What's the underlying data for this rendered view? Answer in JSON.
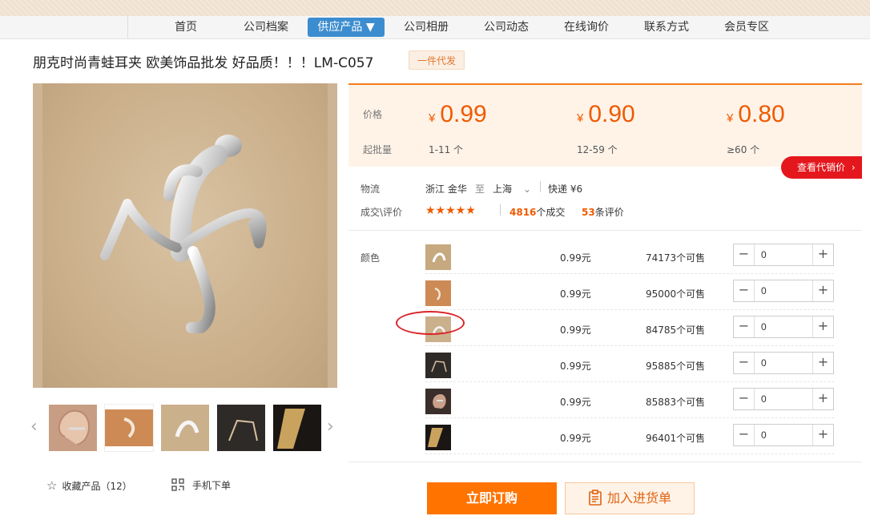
{
  "nav": {
    "items": [
      "首页",
      "公司档案",
      "供应产品 ▼",
      "公司相册",
      "公司动态",
      "在线询价",
      "联系方式",
      "会员专区"
    ]
  },
  "product": {
    "title": "朋克时尚青蛙耳夹 欧美饰品批发 好品质！！！LM-C057",
    "tag": "一件代发"
  },
  "price_section": {
    "price_label": "价格",
    "min_label": "起批量",
    "tiers": [
      {
        "currency": "¥",
        "price": "0.99",
        "range": "1-11 个"
      },
      {
        "currency": "¥",
        "price": "0.90",
        "range": "12-59 个"
      },
      {
        "currency": "¥",
        "price": "0.80",
        "range": "≥60 个"
      }
    ],
    "agent_button": "查看代销价"
  },
  "logistics": {
    "label": "物流",
    "from": "浙江 金华",
    "to_word": "至",
    "to": "上海",
    "express": "快递 ¥6"
  },
  "trades": {
    "label": "成交\\评价",
    "stars": "★★★★★",
    "deals_count": "4816",
    "deals_suffix": "个成交",
    "reviews_count": "53",
    "reviews_suffix": "条评价"
  },
  "sku": {
    "label": "颜色",
    "rows": [
      {
        "price": "0.99元",
        "stock": "74173个可售",
        "qty": "0"
      },
      {
        "price": "0.99元",
        "stock": "95000个可售",
        "qty": "0"
      },
      {
        "price": "0.99元",
        "stock": "84785个可售",
        "qty": "0"
      },
      {
        "price": "0.99元",
        "stock": "95885个可售",
        "qty": "0"
      },
      {
        "price": "0.99元",
        "stock": "85883个可售",
        "qty": "0"
      },
      {
        "price": "0.99元",
        "stock": "96401个可售",
        "qty": "0"
      }
    ]
  },
  "actions": {
    "favorite": "收藏产品（12）",
    "mobile_order": "手机下单",
    "buy_now": "立即订购",
    "add_cart": "加入进货单"
  },
  "colors": {
    "accent_orange": "#f05a00",
    "nav_active": "#3c8dcf",
    "agent_red": "#e4171d"
  }
}
